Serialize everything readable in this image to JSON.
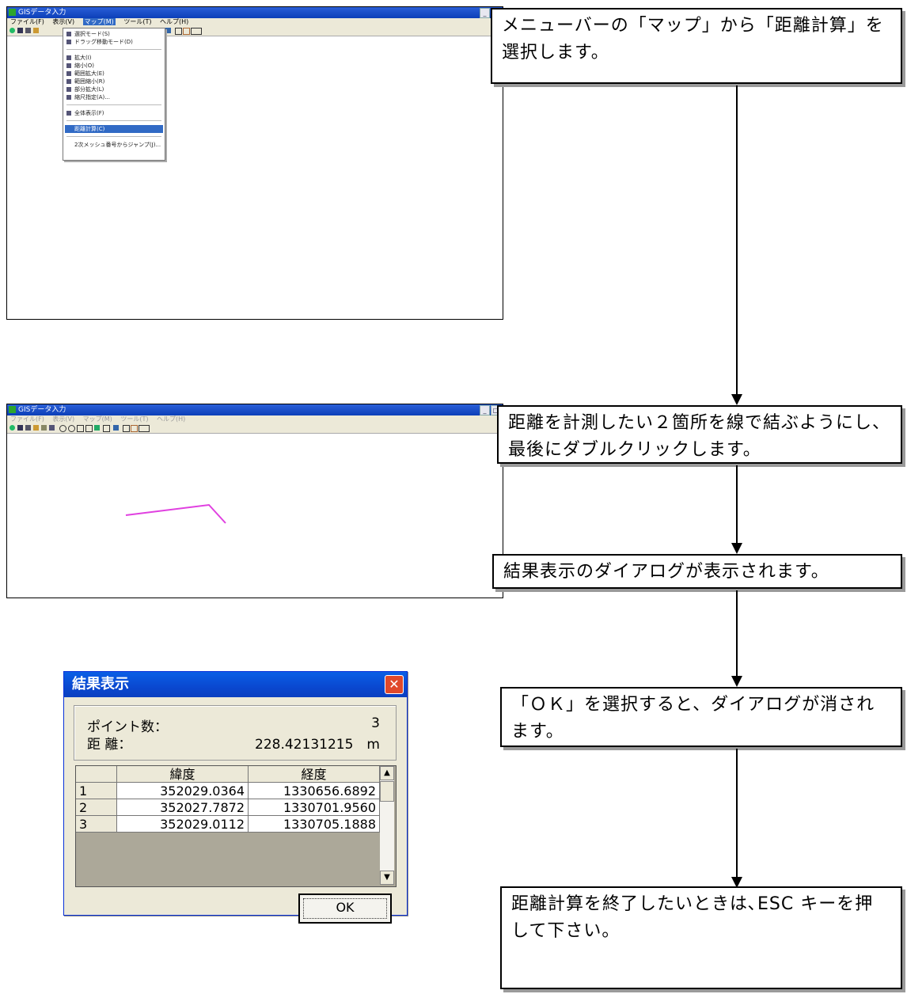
{
  "callouts": {
    "step1": "メニューバーの「マップ」から「距離計算」を選択します。",
    "step2": "距離を計測したい２箇所を線で結ぶようにし、最後にダブルクリックします。",
    "step3": "結果表示のダイアログが表示されます。",
    "step4": "「ＯＫ」を選択すると、ダイアログが消されます。",
    "step5": "距離計算を終了したいときは､ESC キーを押して下さい。"
  },
  "screen1": {
    "window_title": "GISデータ入力",
    "menu": [
      "ファイル(F)",
      "表示(V)",
      "マップ(M)",
      "ツール(T)",
      "ヘルプ(H)"
    ],
    "dropdown": [
      "選択モード(S)",
      "ドラッグ移動モード(D)",
      "拡大(I)",
      "縮小(O)",
      "範囲拡大(E)",
      "範囲縮小(R)",
      "部分拡大(L)",
      "縮尺指定(A)...",
      "全体表示(F)",
      "距離計算(C)",
      "2次メッシュ番号からジャンプ(J)..."
    ]
  },
  "screen2": {
    "window_title": "GISデータ入力",
    "menu": [
      "ファイル(F)",
      "表示(V)",
      "マップ(M)",
      "ツール(T)",
      "ヘルプ(H)"
    ],
    "line_color": "#e040e0"
  },
  "dialog": {
    "title": "結果表示",
    "close_glyph": "✕",
    "points_label": "ポイント数：",
    "points_value": "3",
    "distance_label": "距 離：",
    "distance_value": "228.42131215　m",
    "columns": [
      "緯度",
      "経度"
    ],
    "rows": [
      {
        "no": "1",
        "lat": "352029.0364",
        "lon": "1330656.6892"
      },
      {
        "no": "2",
        "lat": "352027.7872",
        "lon": "1330701.9560"
      },
      {
        "no": "3",
        "lat": "352029.0112",
        "lon": "1330705.1888"
      }
    ],
    "ok_label": "OK"
  }
}
